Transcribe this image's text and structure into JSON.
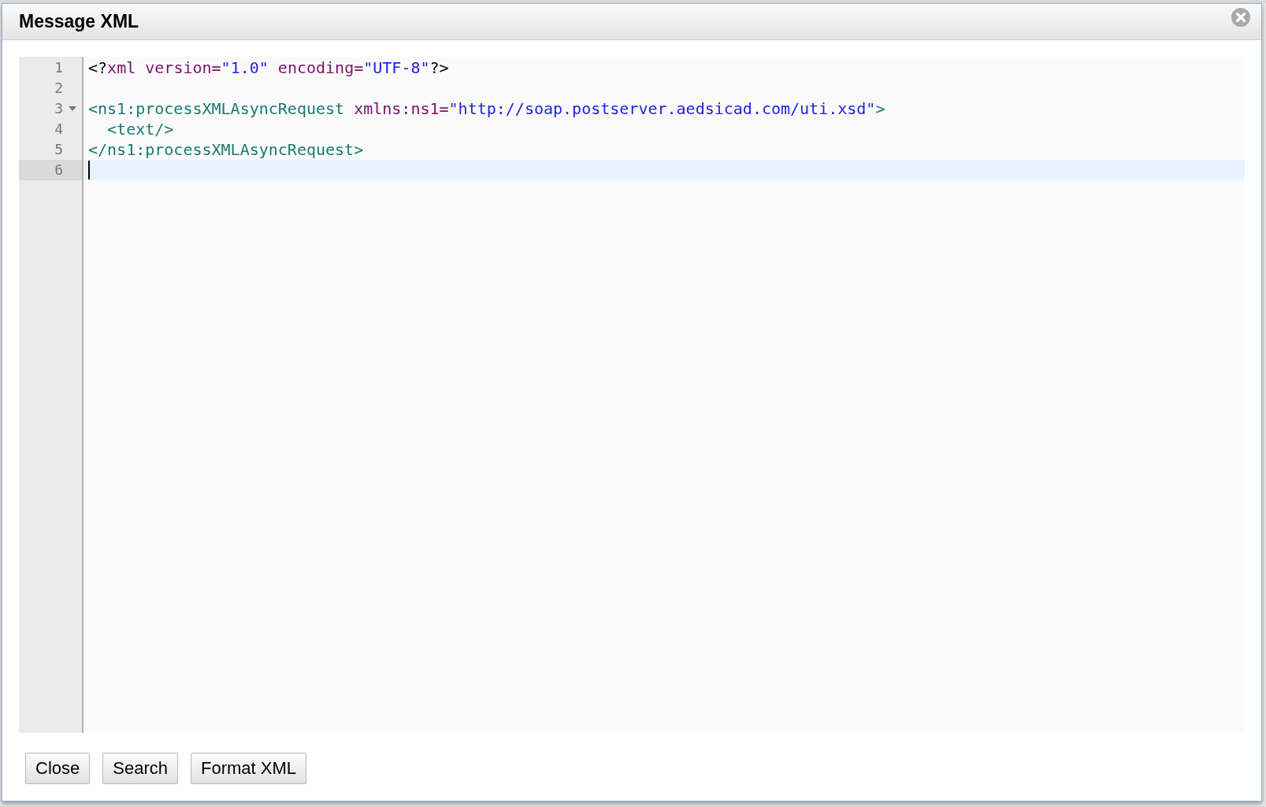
{
  "dialog": {
    "title": "Message XML"
  },
  "editor": {
    "lines": [
      {
        "number": "1",
        "foldable": false,
        "selected": false,
        "tokens": [
          {
            "kind": "punct",
            "text": "<?"
          },
          {
            "kind": "attr",
            "text": "xml version="
          },
          {
            "kind": "string",
            "text": "\"1.0\""
          },
          {
            "kind": "attr",
            "text": " encoding="
          },
          {
            "kind": "string",
            "text": "\"UTF-8\""
          },
          {
            "kind": "punct",
            "text": "?>"
          }
        ]
      },
      {
        "number": "2",
        "foldable": false,
        "selected": false
      },
      {
        "number": "3",
        "foldable": true,
        "selected": false,
        "tokens": [
          {
            "kind": "tag",
            "text": "<ns1:processXMLAsyncRequest"
          },
          {
            "kind": "attr",
            "text": " xmlns:ns1="
          },
          {
            "kind": "string",
            "text": "\"http://soap.postserver.aedsicad.com/uti.xsd\""
          },
          {
            "kind": "tag",
            "text": ">"
          }
        ]
      },
      {
        "number": "4",
        "foldable": false,
        "selected": false,
        "tokens": [
          {
            "kind": "tag",
            "text": "  <text/>"
          }
        ]
      },
      {
        "number": "5",
        "foldable": false,
        "selected": false,
        "tokens": [
          {
            "kind": "tag",
            "text": "</ns1:processXMLAsyncRequest>"
          }
        ]
      },
      {
        "number": "6",
        "foldable": false,
        "selected": true
      }
    ]
  },
  "buttons": [
    "Close",
    "Search",
    "Format XML"
  ]
}
